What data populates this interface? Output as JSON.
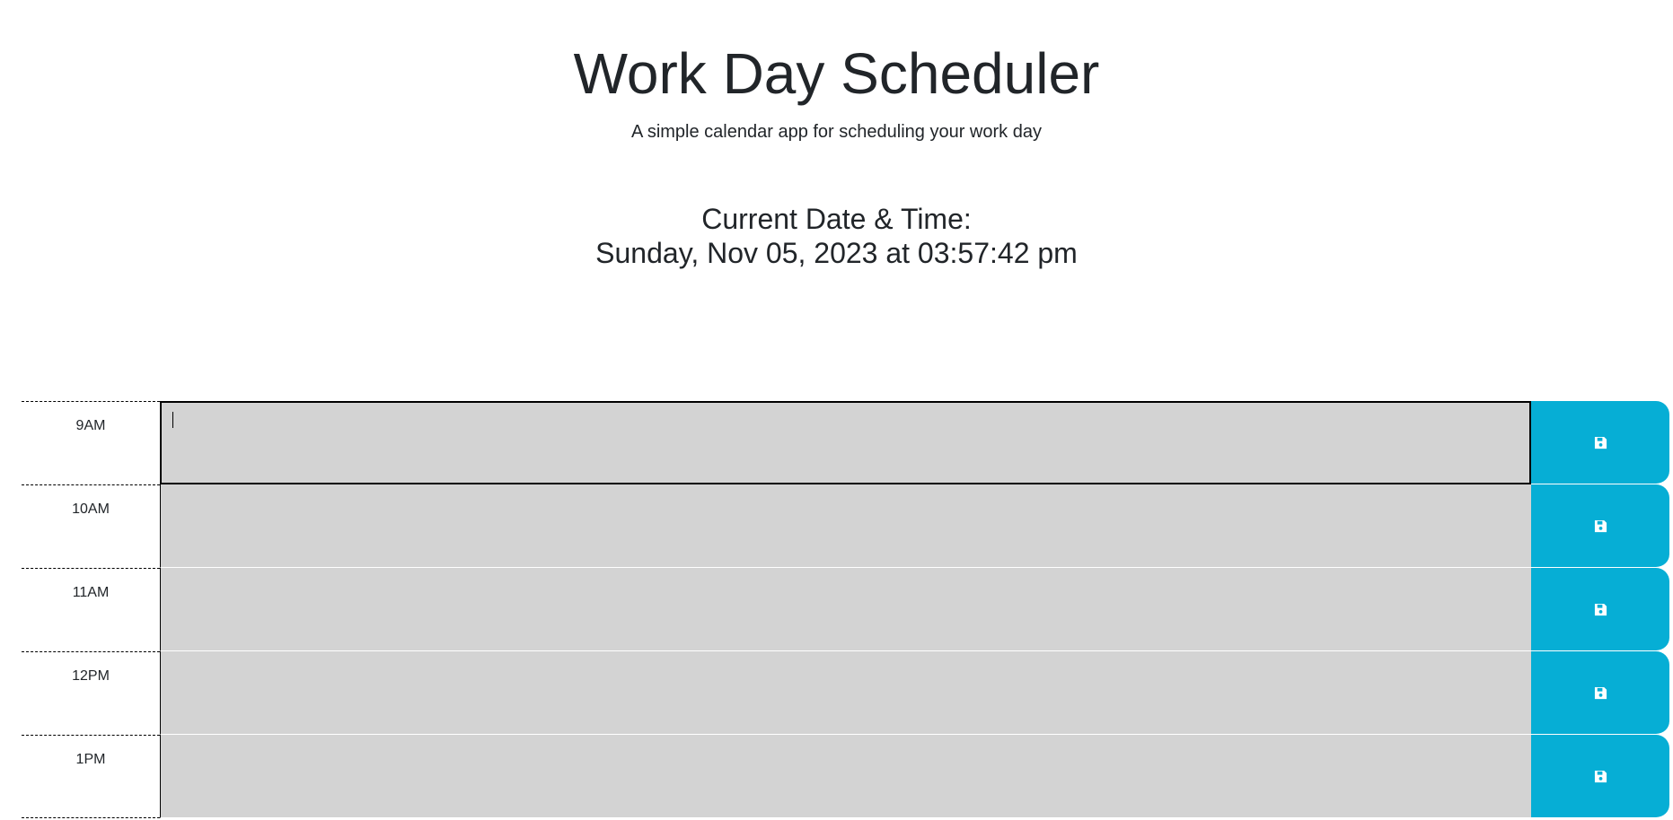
{
  "header": {
    "title": "Work Day Scheduler",
    "subtitle": "A simple calendar app for scheduling your work day"
  },
  "clock": {
    "label": "Current Date & Time:",
    "value": "Sunday, Nov 05, 2023 at 03:57:42 pm"
  },
  "time_blocks": [
    {
      "hour": "9AM",
      "text": "",
      "focused": true
    },
    {
      "hour": "10AM",
      "text": "",
      "focused": false
    },
    {
      "hour": "11AM",
      "text": "",
      "focused": false
    },
    {
      "hour": "12PM",
      "text": "",
      "focused": false
    },
    {
      "hour": "1PM",
      "text": "",
      "focused": false
    }
  ],
  "colors": {
    "block_background": "#d3d3d3",
    "save_button": "#06aed5",
    "save_icon": "#ffffff"
  },
  "icons": {
    "save": "floppy-disk-icon"
  }
}
